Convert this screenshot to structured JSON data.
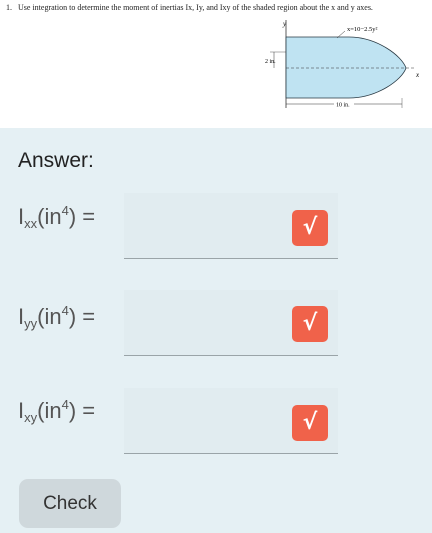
{
  "problem": {
    "number": "1.",
    "text": "Use integration to determine the moment of inertias Ix, Iy, and Ixy of the shaded region about the x and y axes.",
    "diagram": {
      "y_axis_label": "y",
      "x_axis_label": "x",
      "curve_label": "x=10−2.5y²",
      "height_label": "2 in.",
      "length_label": "10 in."
    }
  },
  "answer_title": "Answer:",
  "fields": [
    {
      "label_base": "I",
      "label_sub": "xx",
      "label_open": "(in",
      "label_sup": "4",
      "label_close": ") =",
      "value": "",
      "button_symbol": "√"
    },
    {
      "label_base": "I",
      "label_sub": "yy",
      "label_open": "(in",
      "label_sup": "4",
      "label_close": ") =",
      "value": "",
      "button_symbol": "√"
    },
    {
      "label_base": "I",
      "label_sub": "xy",
      "label_open": "(in",
      "label_sup": "4",
      "label_close": ") =",
      "value": "",
      "button_symbol": "√"
    }
  ],
  "check_label": "Check",
  "colors": {
    "background": "#e5f0f4",
    "input_background": "#e1ecf0",
    "sqrt_button": "#f0624a",
    "check_button": "#cfd8dc",
    "shaded_region": "#bfe3f2"
  }
}
